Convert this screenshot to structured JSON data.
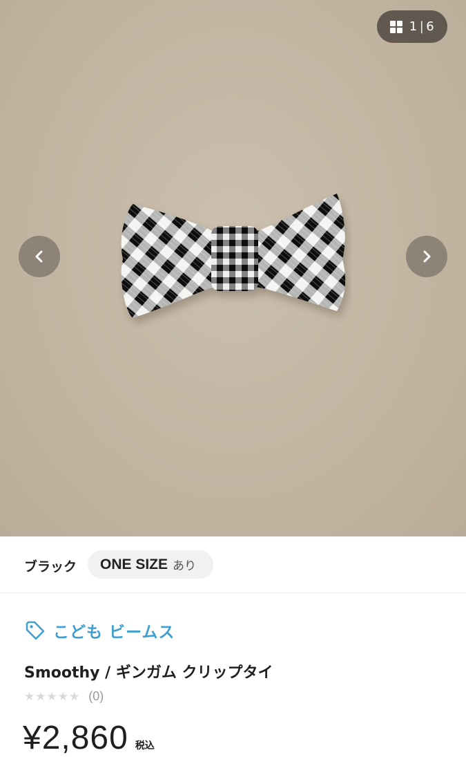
{
  "gallery": {
    "current": "1",
    "separator": "|",
    "total": "6",
    "image_alt": "bow-tie-photo",
    "grid_icon": "grid-icon",
    "prev_icon": "chevron-left-icon",
    "next_icon": "chevron-right-icon"
  },
  "variant": {
    "color": "ブラック",
    "size": "ONE SIZE",
    "stock": "あり"
  },
  "product": {
    "brand": "こども ビームス",
    "brand_icon": "tag-icon",
    "brand_color": "#3f9fcf",
    "title": "Smoothy / ギンガム クリップタイ",
    "rating_count": "(0)",
    "stars": 0,
    "stars_max": 5,
    "price": "¥2,860",
    "tax_label": "税込"
  }
}
